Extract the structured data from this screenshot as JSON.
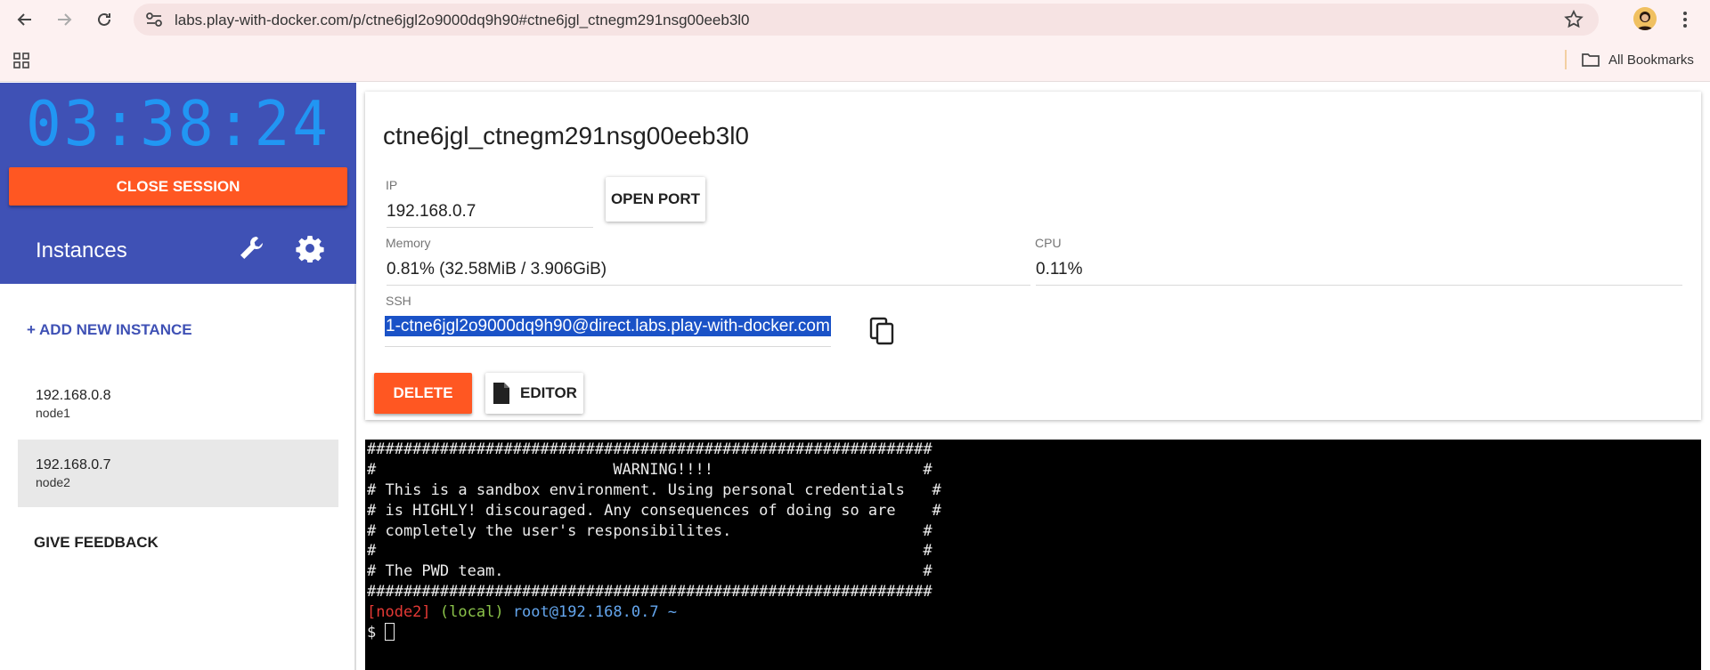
{
  "browser": {
    "url": "labs.play-with-docker.com/p/ctne6jgl2o9000dq9h90#ctne6jgl_ctnegm291nsg00eeb3l0",
    "all_bookmarks": "All Bookmarks"
  },
  "sidebar": {
    "timer": "03:38:24",
    "close_session": "CLOSE SESSION",
    "instances_title": "Instances",
    "add_instance": "+ ADD NEW INSTANCE",
    "instances": [
      {
        "ip": "192.168.0.8",
        "name": "node1",
        "selected": false
      },
      {
        "ip": "192.168.0.7",
        "name": "node2",
        "selected": true
      }
    ],
    "give_feedback": "GIVE FEEDBACK"
  },
  "instance": {
    "hostname": "ctne6jgl_ctnegm291nsg00eeb3l0",
    "ip_label": "IP",
    "ip": "192.168.0.7",
    "open_port": "OPEN PORT",
    "memory_label": "Memory",
    "memory": "0.81% (32.58MiB / 3.906GiB)",
    "cpu_label": "CPU",
    "cpu": "0.11%",
    "ssh_label": "SSH",
    "ssh": "1-ctne6jgl2o9000dq9h90@direct.labs.play-with-docker.com",
    "delete": "DELETE",
    "editor": "EDITOR"
  },
  "terminal": {
    "lines": [
      "##############################################################",
      "#                          WARNING!!!!                       #",
      "# This is a sandbox environment. Using personal credentials   #",
      "# is HIGHLY! discouraged. Any consequences of doing so are    #",
      "# completely the user's responsibilites.                     #",
      "#                                                            #",
      "# The PWD team.                                              #",
      "##############################################################"
    ],
    "prompt_node": "[node2]",
    "prompt_local": "(local)",
    "prompt_user": "root@192.168.0.7 ~",
    "prompt_symbol": "$ "
  },
  "colors": {
    "sidebar_blue": "#3f51b5",
    "accent_orange": "#ff5722",
    "timer_blue": "#2196f3"
  }
}
